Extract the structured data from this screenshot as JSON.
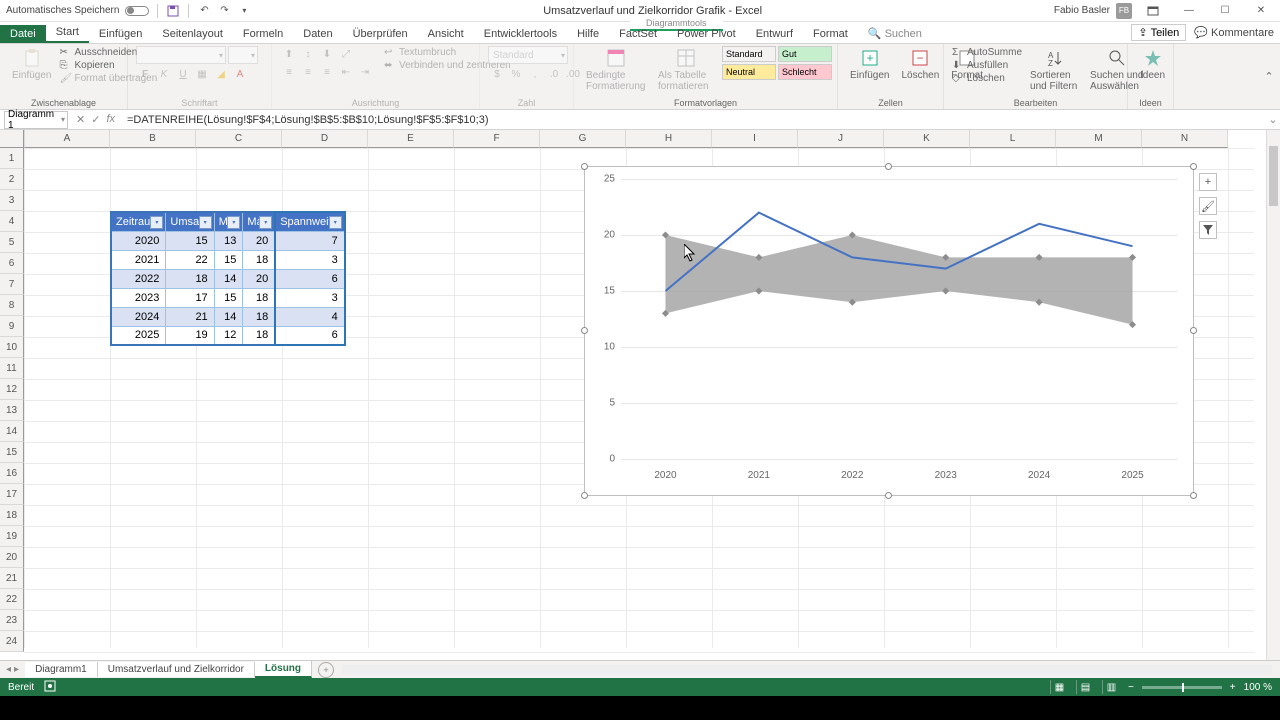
{
  "title": "Umsatzverlauf und Zielkorridor Grafik - Excel",
  "contextual_group": "Diagrammtools",
  "autosave_label": "Automatisches Speichern",
  "user_name": "Fabio Basler",
  "user_initials": "FB",
  "tabs": {
    "file": "Datei",
    "home": "Start",
    "insert": "Einfügen",
    "layout": "Seitenlayout",
    "formulas": "Formeln",
    "data": "Daten",
    "review": "Überprüfen",
    "view": "Ansicht",
    "developer": "Entwicklertools",
    "help": "Hilfe",
    "factset": "FactSet",
    "powerpivot": "Power Pivot",
    "design": "Entwurf",
    "format": "Format"
  },
  "search_label": "Suchen",
  "share_label": "Teilen",
  "comments_label": "Kommentare",
  "ribbon": {
    "paste": "Einfügen",
    "cut": "Ausschneiden",
    "copy": "Kopieren",
    "formatpainter": "Format übertragen",
    "clipboard_group": "Zwischenablage",
    "font_group": "Schriftart",
    "align_group": "Ausrichtung",
    "wrap": "Textumbruch",
    "merge": "Verbinden und zentrieren",
    "number_group": "Zahl",
    "number_format": "Standard",
    "cond_fmt": "Bedingte Formatierung",
    "as_table": "Als Tabelle formatieren",
    "style_standard": "Standard",
    "style_gut": "Gut",
    "style_neutral": "Neutral",
    "style_bad": "Schlecht",
    "styles_group": "Formatvorlagen",
    "insert_cells": "Einfügen",
    "delete_cells": "Löschen",
    "format_cells": "Format",
    "cells_group": "Zellen",
    "autosum": "AutoSumme",
    "fill": "Ausfüllen",
    "clear": "Löschen",
    "sort": "Sortieren und Filtern",
    "find": "Suchen und Auswählen",
    "editing_group": "Bearbeiten",
    "ideas": "Ideen",
    "ideas_group": "Ideen"
  },
  "namebox": "Diagramm 1",
  "formula": "=DATENREIHE(Lösung!$F$4;Lösung!$B$5:$B$10;Lösung!$F$5:$F$10;3)",
  "columns": [
    "A",
    "B",
    "C",
    "D",
    "E",
    "F",
    "G",
    "H",
    "I",
    "J",
    "K",
    "L",
    "M",
    "N"
  ],
  "table": {
    "headers": [
      "Zeitraum",
      "Umsatz",
      "Min",
      "Max",
      "Spannweite"
    ],
    "rows": [
      {
        "zeit": "2020",
        "umsatz": "15",
        "min": "13",
        "max": "20",
        "spann": "7"
      },
      {
        "zeit": "2021",
        "umsatz": "22",
        "min": "15",
        "max": "18",
        "spann": "3"
      },
      {
        "zeit": "2022",
        "umsatz": "18",
        "min": "14",
        "max": "20",
        "spann": "6"
      },
      {
        "zeit": "2023",
        "umsatz": "17",
        "min": "15",
        "max": "18",
        "spann": "3"
      },
      {
        "zeit": "2024",
        "umsatz": "21",
        "min": "14",
        "max": "18",
        "spann": "4"
      },
      {
        "zeit": "2025",
        "umsatz": "19",
        "min": "12",
        "max": "18",
        "spann": "6"
      }
    ]
  },
  "chart_data": {
    "type": "line",
    "categories": [
      "2020",
      "2021",
      "2022",
      "2023",
      "2024",
      "2025"
    ],
    "series": [
      {
        "name": "Umsatz",
        "values": [
          15,
          22,
          18,
          17,
          21,
          19
        ],
        "kind": "line",
        "color": "#4472C4"
      },
      {
        "name": "Min",
        "values": [
          13,
          15,
          14,
          15,
          14,
          12
        ],
        "kind": "area-lower",
        "color": "#a6a6a6"
      },
      {
        "name": "Max",
        "values": [
          20,
          18,
          20,
          18,
          18,
          18
        ],
        "kind": "area-upper",
        "color": "#a6a6a6"
      }
    ],
    "ylim": [
      0,
      25
    ],
    "yticks": [
      0,
      5,
      10,
      15,
      20,
      25
    ],
    "xlabel": "",
    "ylabel": "",
    "title": ""
  },
  "sheets": {
    "s1": "Diagramm1",
    "s2": "Umsatzverlauf und Zielkorridor",
    "s3": "Lösung"
  },
  "status": {
    "ready": "Bereit",
    "zoom": "100 %"
  }
}
